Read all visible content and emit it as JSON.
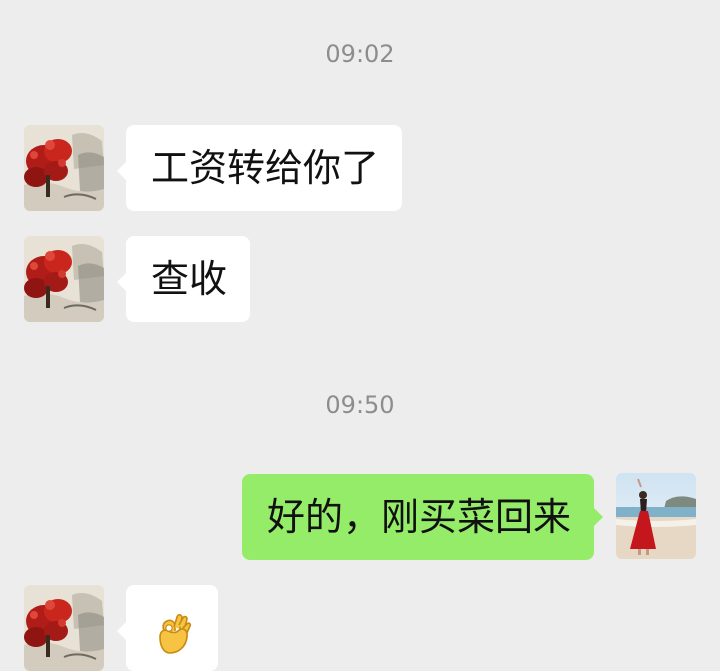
{
  "chat": {
    "timestamps": [
      "09:02",
      "09:50"
    ],
    "messages": [
      {
        "side": "in",
        "text": "工资转给你了",
        "avatar": "landscape-painting-avatar"
      },
      {
        "side": "in",
        "text": "查收",
        "avatar": "landscape-painting-avatar"
      },
      {
        "side": "out",
        "text": "好的，刚买菜回来",
        "avatar": "beach-woman-red-dress-avatar"
      },
      {
        "side": "in",
        "text": "",
        "emoji": "ok-hand-icon",
        "avatar": "landscape-painting-avatar"
      }
    ]
  },
  "colors": {
    "background": "#ededed",
    "incoming_bubble": "#ffffff",
    "outgoing_bubble": "#95ec69",
    "timestamp_text": "#8d8d8d",
    "message_text": "#111111"
  }
}
